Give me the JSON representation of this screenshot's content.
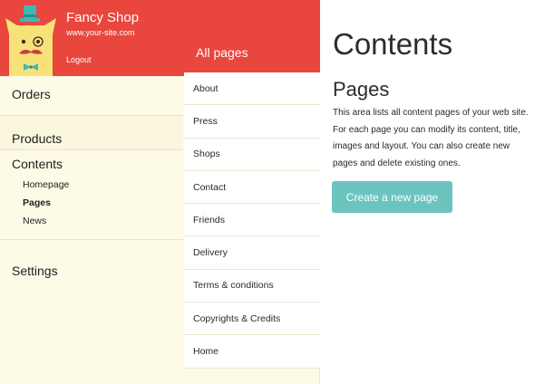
{
  "brand": {
    "name": "Fancy Shop",
    "url": "www.your-site.com",
    "logout_label": "Logout",
    "mascot_icon": "cat-mascot-icon",
    "header_color": "#e9463e"
  },
  "sidebar": {
    "items": [
      {
        "label": "Orders"
      },
      {
        "label": "Products"
      },
      {
        "label": "Contents"
      },
      {
        "label": "Settings"
      }
    ],
    "contents_subitems": [
      {
        "label": "Homepage"
      },
      {
        "label": "Pages",
        "active": true
      },
      {
        "label": "News"
      }
    ]
  },
  "pages_column": {
    "header_label": "All pages",
    "pages": [
      "About",
      "Press",
      "Shops",
      "Contact",
      "Friends",
      "Delivery",
      "Terms & conditions",
      "Copyrights & Credits",
      "Home"
    ]
  },
  "main": {
    "title": "Contents",
    "section_title": "Pages",
    "description": "This area lists all content pages of your web site. For each page you can modify its content, title, images and layout. You can also create new pages and delete existing ones.",
    "create_button_label": "Create a new page",
    "button_color": "#6cc4c0"
  }
}
